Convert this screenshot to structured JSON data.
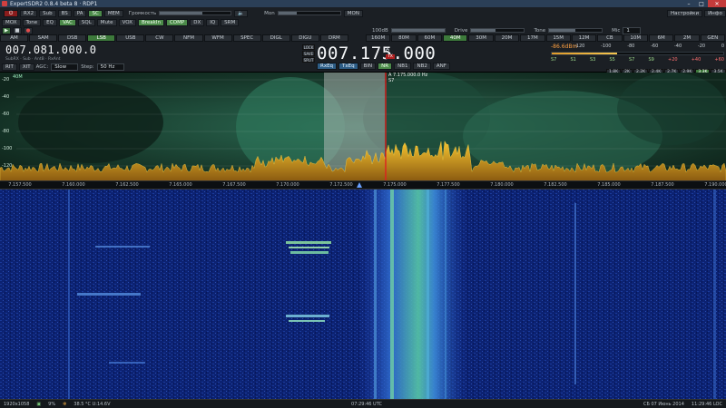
{
  "window": {
    "title": "ExpertSDR2 0.8.4 beta 8 · RDP1"
  },
  "toolbar1": {
    "rx2": "RX2",
    "sub": "Sub",
    "bs": "BS",
    "pa": "PA",
    "sc": "SC",
    "mem": "MEM",
    "volume_label": "Громкость",
    "mon_label": "Mon",
    "mon_btn": "MON",
    "settings": "Настройки",
    "info": "Инфо"
  },
  "toolbar2": {
    "mox": "MOX",
    "tone": "Tone",
    "eq": "EQ",
    "vac": "VAC",
    "sql": "SQL",
    "mute": "Mute",
    "vox": "VOX",
    "breakin": "BreakIn",
    "comp": "COMP",
    "dx": "DX",
    "iq": "IQ",
    "srm": "SRM",
    "level_value": "100dB",
    "drive_label": "Drive",
    "tone_label": "Tone",
    "mic_label": "Mic",
    "mic_value": "1"
  },
  "modes": [
    {
      "label": "AM",
      "active": false
    },
    {
      "label": "SAM",
      "active": false
    },
    {
      "label": "DSB",
      "active": false
    },
    {
      "label": "LSB",
      "active": true
    },
    {
      "label": "USB",
      "active": false
    },
    {
      "label": "CW",
      "active": false
    },
    {
      "label": "NFM",
      "active": false
    },
    {
      "label": "WFM",
      "active": false
    },
    {
      "label": "SPEC",
      "active": false
    },
    {
      "label": "DIGL",
      "active": false
    },
    {
      "label": "DIGU",
      "active": false
    },
    {
      "label": "DRM",
      "active": false
    }
  ],
  "bands": [
    {
      "label": "160M",
      "active": false
    },
    {
      "label": "80M",
      "active": false
    },
    {
      "label": "60M",
      "active": false
    },
    {
      "label": "40M",
      "active": true
    },
    {
      "label": "30M",
      "active": false
    },
    {
      "label": "20M",
      "active": false
    },
    {
      "label": "17M",
      "active": false
    },
    {
      "label": "15M",
      "active": false
    },
    {
      "label": "12M",
      "active": false
    },
    {
      "label": "CB",
      "active": false
    },
    {
      "label": "10M",
      "active": false
    },
    {
      "label": "6M",
      "active": false
    },
    {
      "label": "2M",
      "active": false
    },
    {
      "label": "GEN",
      "active": false
    }
  ],
  "vfo_sub": {
    "digits": "007.081.000.0",
    "sub_labels": "SubRX · Sub · AntB · RxAnt"
  },
  "vfo_main": {
    "digits": "007.175.000",
    "side_buttons": [
      "LOCK",
      "SAVE",
      "SPLIT"
    ],
    "ab": "A",
    "tx": "TX"
  },
  "vfo_row3": {
    "rxeq": "RxEq",
    "txeq": "TxEq",
    "bin": "BIN",
    "nr": "NR",
    "nb1": "NB1",
    "nb2": "NB2",
    "anf": "ANF"
  },
  "row4": {
    "rit": "RIT",
    "xit": "XIT",
    "agc_label": "AGC:",
    "agc_value": "Slow",
    "step_label": "Step:",
    "step_value": "50 Hz"
  },
  "smeter": {
    "dbm": "-86.6dBm",
    "top_scale": [
      "-120",
      "-100",
      "-80",
      "-60",
      "-40",
      "-20",
      "0"
    ],
    "bottom_scale": [
      "S7",
      "S1",
      "S3",
      "S5",
      "S7",
      "S9",
      "+20",
      "+40",
      "+60"
    ],
    "fill_fraction": 0.38
  },
  "filters": [
    {
      "label": "1.8K",
      "active": false
    },
    {
      "label": "2K",
      "active": false
    },
    {
      "label": "2.2K",
      "active": false
    },
    {
      "label": "2.4K",
      "active": false
    },
    {
      "label": "2.7K",
      "active": false
    },
    {
      "label": "2.9K",
      "active": false
    },
    {
      "label": "3.3K",
      "active": true
    },
    {
      "label": "3.5K",
      "active": false
    },
    {
      "label": "3.8K",
      "active": false
    },
    {
      "label": "VAR",
      "active": false
    }
  ],
  "spectrum": {
    "db_labels": [
      "-20",
      "-40",
      "-60",
      "-80",
      "-100",
      "-120"
    ],
    "band_label": "40M",
    "marker_label": "A   7.175.000.0 Hz",
    "marker_s": "S7"
  },
  "freq_axis": [
    "7.157.500",
    "7.160.000",
    "7.162.500",
    "7.165.000",
    "7.167.500",
    "7.170.000",
    "7.172.500",
    "7.175.000",
    "7.177.500",
    "7.180.000",
    "7.182.500",
    "7.185.000",
    "7.187.500",
    "7.190.000"
  ],
  "status": {
    "resolution": "1920x1058",
    "cpu": "9%",
    "temp": "38.5 °C  U:14.6V",
    "utc": "07:29:46 UTC",
    "date": "СБ 07 Июнь 2014",
    "local": "11:29:46 LOC"
  },
  "colors": {
    "accent_green": "#3d7a3b",
    "spectrum_line": "#f2a821",
    "marker_red": "#e01f1f",
    "waterfall_bg": "#0b1f6e"
  }
}
